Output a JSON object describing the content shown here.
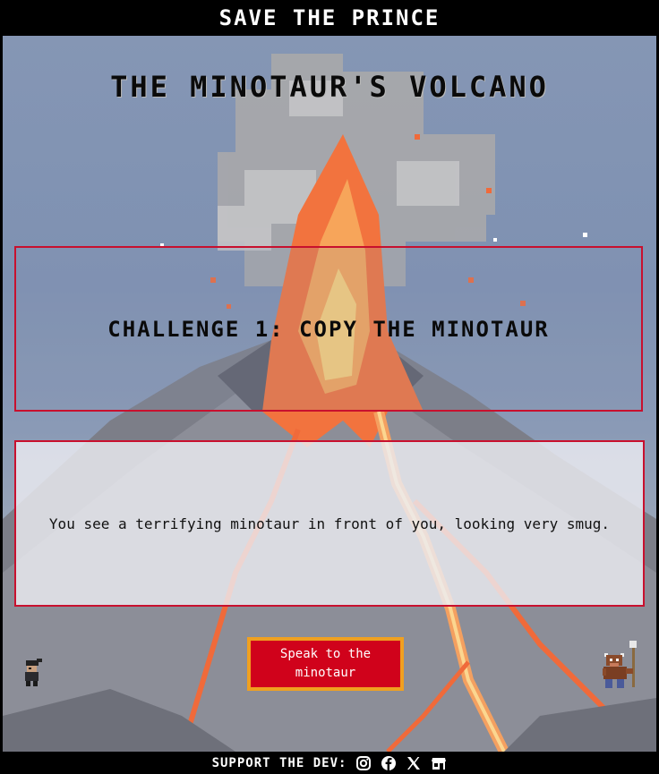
{
  "header": {
    "title": "SAVE THE PRINCE"
  },
  "scene": {
    "title": "THE MINOTAUR'S VOLCANO"
  },
  "challenge": {
    "label": "CHALLENGE 1: COPY THE MINOTAUR"
  },
  "story": {
    "text": "You see a terrifying minotaur in front of you, looking very smug."
  },
  "action": {
    "button_label": "Speak to the minotaur"
  },
  "footer": {
    "support_label": "SUPPORT THE DEV:",
    "icons": [
      "instagram-icon",
      "facebook-icon",
      "x-icon",
      "store-icon"
    ]
  },
  "colors": {
    "accent_red": "#c8102e",
    "button_red": "#d0021b",
    "button_border": "#f0a020",
    "lava": "#f06a3a",
    "header_bg": "#000000"
  }
}
